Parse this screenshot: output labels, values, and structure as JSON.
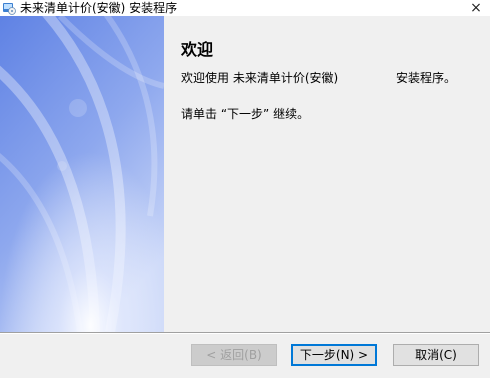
{
  "window": {
    "title": "未来清单计价(安徽) 安装程序",
    "close_glyph": "×"
  },
  "content": {
    "heading": "欢迎",
    "welcome_prefix": "欢迎使用 未来清单计价(安徽)",
    "welcome_suffix": "安装程序。",
    "instruction": "请单击 “下一步” 继续。"
  },
  "buttons": {
    "back_label": "< 返回(B)",
    "next_label": "下一步(N) >",
    "cancel_label": "取消(C)"
  },
  "colors": {
    "banner_blue": "#6f8fe8",
    "accent": "#0078d7"
  },
  "icons": {
    "app": "installer-icon",
    "close": "close-icon"
  }
}
